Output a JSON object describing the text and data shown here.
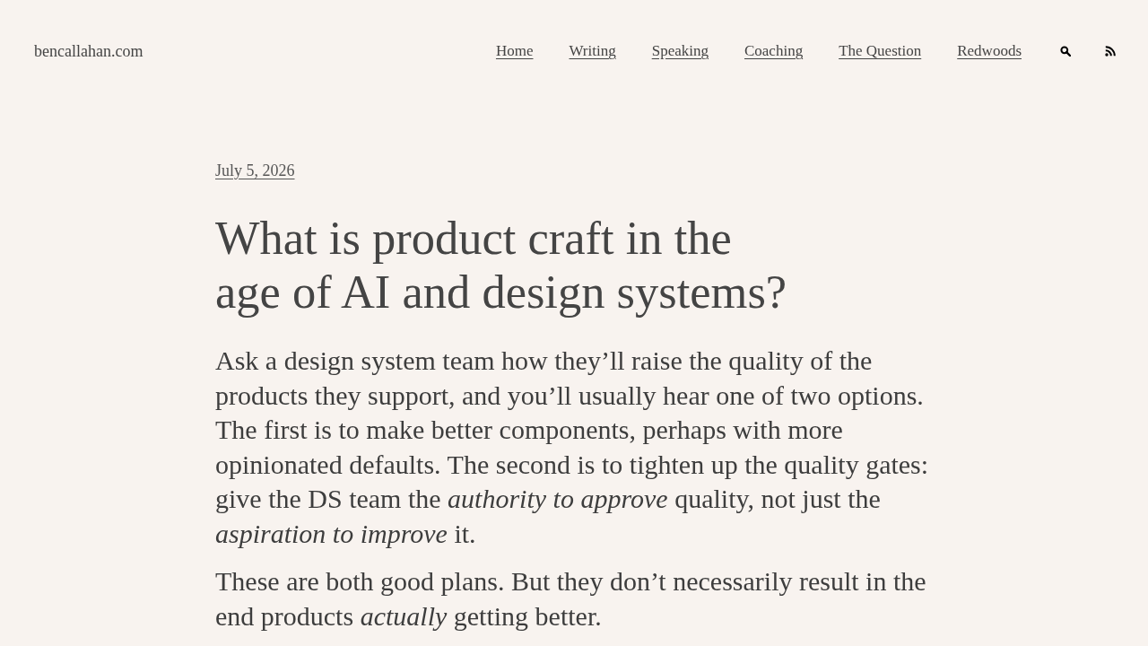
{
  "site_title": "bencallahan.com",
  "nav": [
    "Home",
    "Writing",
    "Speaking",
    "Coaching",
    "The Question",
    "Redwoods"
  ],
  "post": {
    "date": "July 5, 2026",
    "title": "What is product craft in the age of AI and design systems?",
    "paragraphs": [
      "Ask a design system team how they’ll raise the quality of the products they support, and you’ll usually hear one of two options. The first is to make better components, perhaps with more opinionated defaults. The second is to tighten up the quality gates: give the DS team the *authority to approve* quality, not just the *aspiration to improve* it.",
      "These are both good plans. But they don’t necessarily result in the end products *actually* getting better."
    ]
  }
}
